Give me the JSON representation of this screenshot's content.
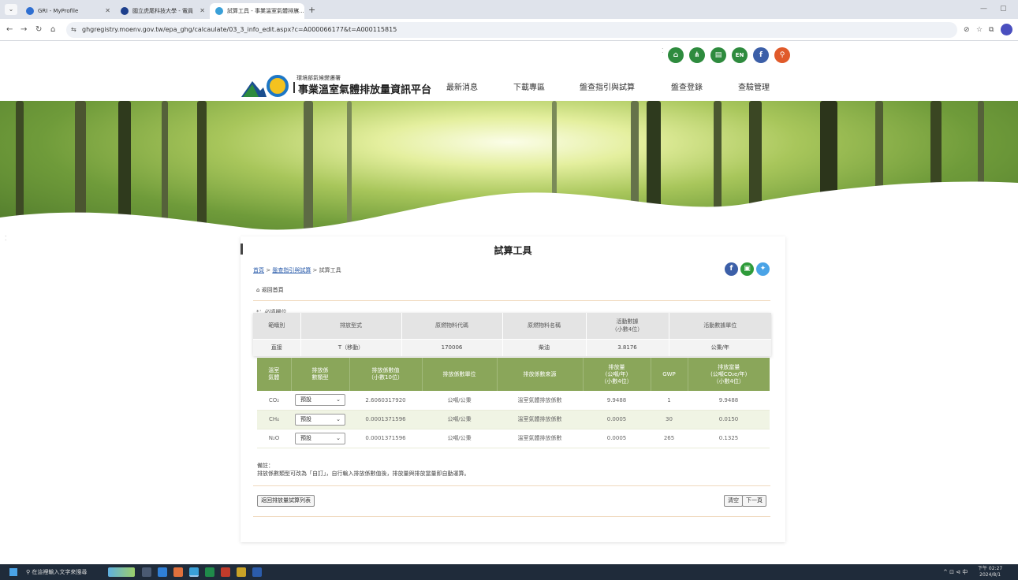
{
  "browser": {
    "tabs": [
      {
        "title": "GRI - MyProfile",
        "favicon_color": "#2f6fd1"
      },
      {
        "title": "國立虎尾科技大學 - 電員",
        "favicon_color": "#1d3f8c"
      },
      {
        "title": "試算工具 - 事業溫室氣體排放...",
        "favicon_color": "#3aa0d8"
      }
    ],
    "url": "ghgregistry.moenv.gov.tw/epa_ghg/calcaulate/03_3_info_edit.aspx?c=A000066177&t=A000115815"
  },
  "site": {
    "top_icons": [
      {
        "name": "home-icon",
        "glyph": "⌂",
        "color": "#2e8b3e"
      },
      {
        "name": "sitemap-icon",
        "glyph": "⚲",
        "color": "#2e8b3e"
      },
      {
        "name": "chat-icon",
        "glyph": "▤",
        "color": "#2e8b3e"
      },
      {
        "name": "language-icon",
        "glyph": "EN",
        "color": "#2e8b3e"
      },
      {
        "name": "facebook-icon",
        "glyph": "f",
        "color": "#3c5fa8"
      },
      {
        "name": "search-icon",
        "glyph": "⚲",
        "color": "#e05a2a"
      }
    ],
    "brand_sub": "環境部氣候變遷署",
    "brand_main": "事業溫室氣體排放量資訊平台",
    "nav": [
      "最新消息",
      "下載專區",
      "盤查指引與試算",
      "盤查登錄",
      "查驗管理"
    ]
  },
  "page": {
    "title": "試算工具",
    "breadcrumb": {
      "home": "首頁",
      "sep1": " > ",
      "guide": "盤查指引與試算",
      "sep2": " > ",
      "current": "試算工具"
    },
    "back_home": "返回首頁",
    "required_note": "*：必填欄位",
    "info_table": {
      "headers": [
        "範疇別",
        "排放型式",
        "原燃物料代碼",
        "原燃物料名稱",
        "活動數據",
        "活動數據單位"
      ],
      "header_sub": "（小數4位）",
      "row": [
        "直接",
        "T（移動）",
        "170006",
        "柴油",
        "3.8176",
        "公秉/年"
      ]
    },
    "gas_table": {
      "headers": [
        [
          "溫室",
          "氣體"
        ],
        [
          "排放係",
          "數類型"
        ],
        [
          "排放係數值",
          "（小數10位）"
        ],
        [
          "排放係數單位"
        ],
        [
          "排放係數來源"
        ],
        [
          "排放量",
          "(公噸/年)",
          "（小數4位）"
        ],
        [
          "GWP"
        ],
        [
          "排放當量",
          "(公噸CO₂e/年)",
          "（小數4位）"
        ]
      ],
      "rows": [
        {
          "gas": "CO₂",
          "type": "預設",
          "factor": "2.6060317920",
          "unit": "公噸/公秉",
          "source": "溫室氣體排放係數",
          "emission": "9.9488",
          "gwp": "1",
          "equiv": "9.9488"
        },
        {
          "gas": "CH₄",
          "type": "預設",
          "factor": "0.0001371596",
          "unit": "公噸/公秉",
          "source": "溫室氣體排放係數",
          "emission": "0.0005",
          "gwp": "30",
          "equiv": "0.0150"
        },
        {
          "gas": "N₂O",
          "type": "預設",
          "factor": "0.0001371596",
          "unit": "公噸/公秉",
          "source": "溫室氣體排放係數",
          "emission": "0.0005",
          "gwp": "265",
          "equiv": "0.1325"
        }
      ]
    },
    "note_title": "備註：",
    "note_text": "排放係數類型可改為「自訂」，自行輸入排放係數值後，排放量與排放當量即自動運算。",
    "buttons": {
      "back_list": "返回排放量試算列表",
      "clear": "清空",
      "next": "下一頁"
    }
  },
  "taskbar": {
    "search_placeholder": "在這裡輸入文字來搜尋",
    "tray_text": "^ ⊡ ⊲ 中",
    "time": "下午 02:27",
    "date": "2024/8/1"
  }
}
